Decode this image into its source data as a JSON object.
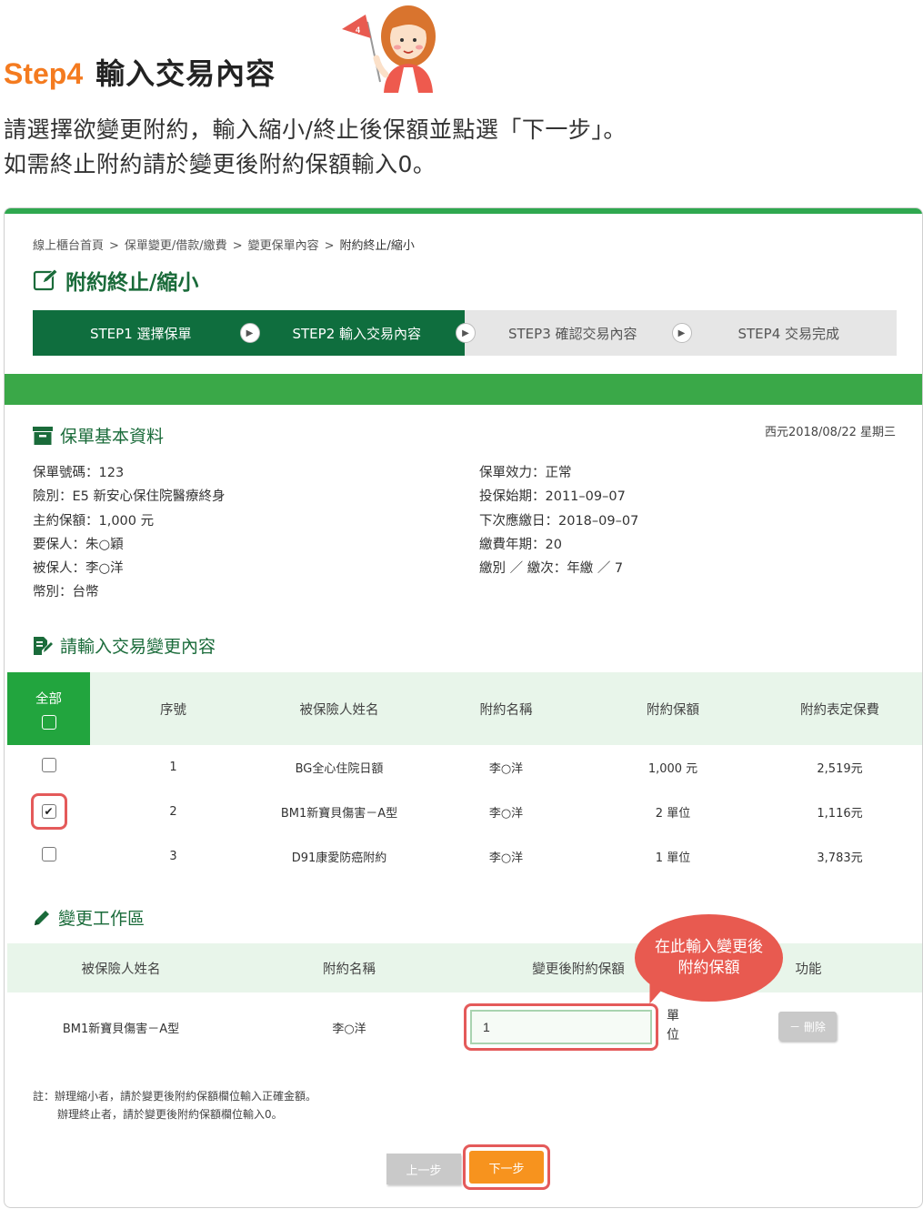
{
  "header": {
    "step_no": "Step4",
    "step_name": "輸入交易內容",
    "mascot_flag": "4",
    "instruction_line1": "請選擇欲變更附約，輸入縮小/終止後保額並點選「下一步」。",
    "instruction_line2": "如需終止附約請於變更後附約保額輸入0。"
  },
  "breadcrumb": [
    "線上櫃台首頁",
    "保單變更/借款/繳費",
    "變更保單內容",
    "附約終止/縮小"
  ],
  "breadcrumb_sep": ">",
  "page_title": "附約終止/縮小",
  "steps": [
    {
      "label": "STEP1 選擇保單",
      "state": "active"
    },
    {
      "label": "STEP2 輸入交易內容",
      "state": "active"
    },
    {
      "label": "STEP3 確認交易內容",
      "state": "inactive"
    },
    {
      "label": "STEP4 交易完成",
      "state": "inactive"
    }
  ],
  "policy_info": {
    "heading": "保單基本資料",
    "date": "西元2018/08/22 星期三",
    "left": [
      "保單號碼：123",
      "險別：E5 新安心保住院醫療終身",
      "主約保額：1,000 元",
      "要保人：朱○穎",
      "被保人：李○洋",
      "幣別：台幣"
    ],
    "right": [
      "保單效力：正常",
      "投保始期：2011–09–07",
      "下次應繳日：2018–09–07",
      "繳費年期：20",
      "繳別 ／ 繳次：年繳 ／ 7"
    ]
  },
  "change_input": {
    "heading": "請輸入交易變更內容",
    "headers": {
      "all": "全部",
      "seq": "序號",
      "insured": "被保險人姓名",
      "rider": "附約名稱",
      "amount": "附約保額",
      "premium": "附約表定保費"
    },
    "rows": [
      {
        "checked": false,
        "seq": "1",
        "insured": "BG全心住院日額",
        "rider": "李○洋",
        "amount": "1,000 元",
        "premium": "2,519元"
      },
      {
        "checked": true,
        "seq": "2",
        "insured": "BM1新寶貝傷害－A型",
        "rider": "李○洋",
        "amount": "2 單位",
        "premium": "1,116元"
      },
      {
        "checked": false,
        "seq": "3",
        "insured": "D91康愛防癌附約",
        "rider": "李○洋",
        "amount": "1 單位",
        "premium": "3,783元"
      }
    ]
  },
  "workspace": {
    "heading": "變更工作區",
    "headers": {
      "insured": "被保險人姓名",
      "rider": "附約名稱",
      "new_amount": "變更後附約保額",
      "function": "功能"
    },
    "row": {
      "insured": "BM1新寶貝傷害－A型",
      "rider": "李○洋",
      "value": "1",
      "unit": "單位",
      "delete_label": "－ 刪除"
    },
    "bubble_line1": "在此輸入變更後",
    "bubble_line2": "附約保額"
  },
  "note": {
    "line1": "註：辦理縮小者，請於變更後附約保額欄位輸入正確金額。",
    "line2": "辦理終止者，請於變更後附約保額欄位輸入0。"
  },
  "buttons": {
    "prev": "上一步",
    "next": "下一步"
  },
  "colors": {
    "brand_green": "#0f6e3e",
    "band_green": "#3aa848",
    "header_green": "#22a53e",
    "accent_orange": "#f7931e",
    "step_title_orange": "#f47b20",
    "highlight_red": "#e45a5a"
  }
}
